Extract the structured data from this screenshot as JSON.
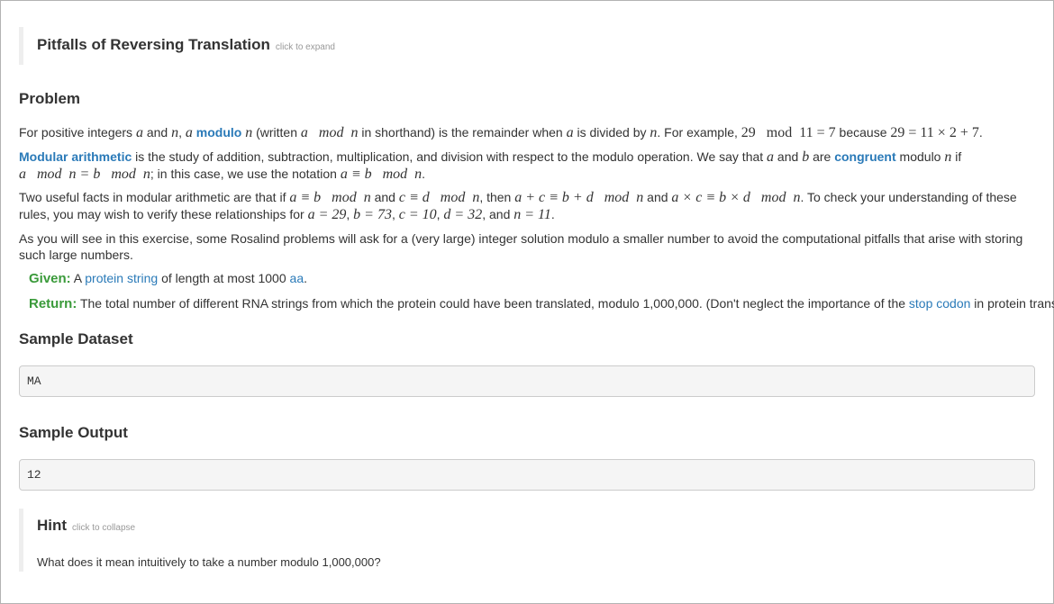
{
  "expand": {
    "title": "Pitfalls of Reversing Translation",
    "hint": "click to expand"
  },
  "problem": {
    "heading": "Problem",
    "p1": {
      "t1": "For positive integers ",
      "m_a": "a",
      "t2": " and ",
      "m_n": "n",
      "t3": ", ",
      "m_a2": "a",
      "link_modulo": "modulo",
      "m_n2": "n",
      "t4": " (written ",
      "m_written": "a   mod  n",
      "t5": " in shorthand) is the remainder when ",
      "m_a3": "a",
      "t6": " is divided by ",
      "m_n3": "n",
      "t7": ". For example, ",
      "m_ex1": "29   mod  11 = 7",
      "t8": " because ",
      "m_ex2": "29 = 11 × 2 + 7",
      "t9": "."
    },
    "p2": {
      "link_modarith": "Modular arithmetic",
      "t1": " is the study of addition, subtraction, multiplication, and division with respect to the modulo operation. We say that ",
      "m_a": "a",
      "t2": " and ",
      "m_b": "b",
      "t3": " are ",
      "link_congruent": "congruent",
      "t4": " modulo ",
      "m_n": "n",
      "t5": " if",
      "m_line2": "a   mod  n = b   mod  n",
      "t6": "; in this case, we use the notation ",
      "m_not": "a ≡ b   mod  n",
      "t7": "."
    },
    "p3": {
      "t1": "Two useful facts in modular arithmetic are that if ",
      "m1": "a ≡ b   mod  n",
      "t2": " and ",
      "m2": "c ≡ d   mod  n",
      "t3": ", then ",
      "m3": "a + c ≡ b + d   mod  n",
      "t4": " and ",
      "m4": "a × c ≡ b × d   mod  n",
      "t5": ". To check your understanding of these rules, you may wish to verify these relationships for ",
      "m5": "a = 29",
      "t6": ", ",
      "m6": "b = 73",
      "t7": ", ",
      "m7": "c = 10",
      "t8": ", ",
      "m8": "d = 32",
      "t9": ", and ",
      "m9": "n = 11",
      "t10": "."
    },
    "p4": "As you will see in this exercise, some Rosalind problems will ask for a (very large) integer solution modulo a smaller number to avoid the computational pitfalls that arise with storing such large numbers.",
    "given": {
      "label": "Given:",
      "t1": " A ",
      "link_protein": "protein string",
      "t2": " of length at most 1000 ",
      "link_aa": "aa",
      "t3": "."
    },
    "ret": {
      "label": "Return:",
      "t1": " The total number of different RNA strings from which the protein could have been translated, modulo 1,000,000. (Don't neglect the importance of the ",
      "link_stop": "stop codon",
      "t2": " in protein translation.)"
    }
  },
  "sample_dataset": {
    "heading": "Sample Dataset",
    "value": "MA"
  },
  "sample_output": {
    "heading": "Sample Output",
    "value": "12"
  },
  "hint": {
    "title": "Hint",
    "toggle": "click to collapse",
    "text": "What does it mean intuitively to take a number modulo 1,000,000?"
  }
}
